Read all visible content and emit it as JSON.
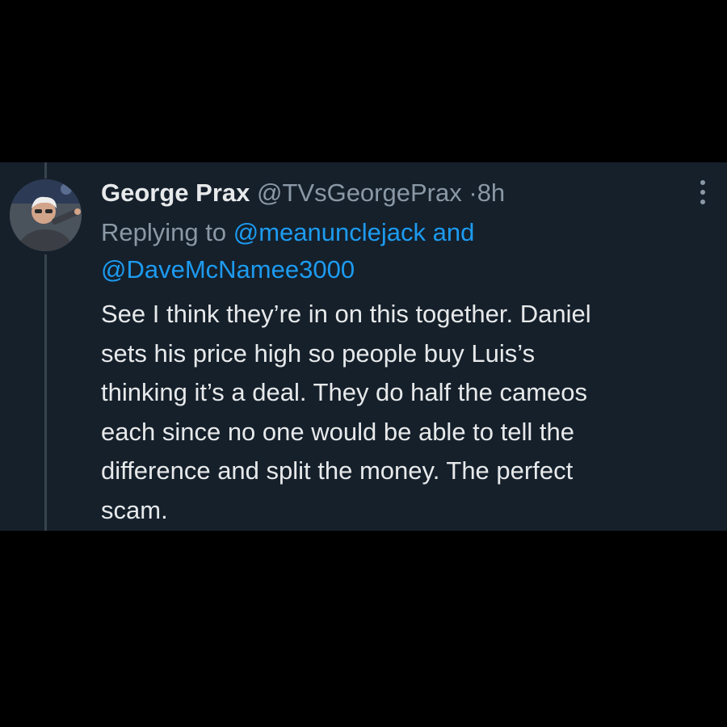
{
  "tweet": {
    "author": {
      "display_name": "George Prax",
      "handle": "@TVsGeorgePrax",
      "separator": "·",
      "time": "8h"
    },
    "reply": {
      "prefix": "Replying to",
      "mention_1": "@meanunclejack",
      "conjunction": "and",
      "mention_2": "@DaveMcNamee3000"
    },
    "lines": [
      "See I think they’re in on this together. Daniel",
      "sets his price high so people buy Luis’s",
      "thinking it’s a deal. They do half the cameos",
      "each since no one would be able to tell the",
      "difference and split the money. The perfect",
      "scam."
    ],
    "icons": {
      "more": "more-options-icon",
      "avatar": "profile-avatar"
    },
    "colors": {
      "background": "#15202b",
      "text": "#e7e9ea",
      "secondary": "#8b98a5",
      "accent": "#1d9bf0"
    }
  }
}
